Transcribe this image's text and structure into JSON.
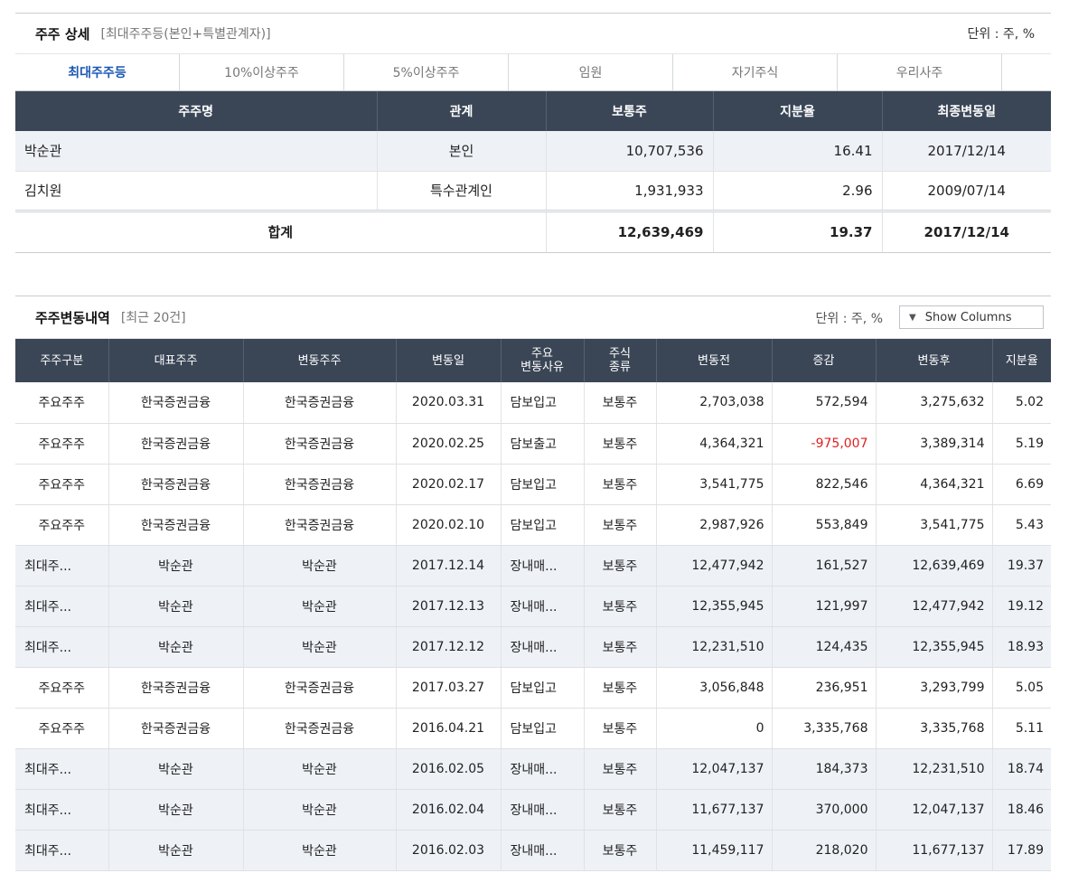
{
  "detail": {
    "title": "주주 상세",
    "subtitle": "[최대주주등(본인+특별관계자)]",
    "unit": "단위 : 주, %",
    "tabs": [
      "최대주주등",
      "10%이상주주",
      "5%이상주주",
      "임원",
      "자기주식",
      "우리사주",
      ""
    ],
    "active_tab": 0,
    "columns": [
      "주주명",
      "관계",
      "보통주",
      "지분율",
      "최종변동일"
    ],
    "rows": [
      {
        "name": "박순관",
        "relation": "본인",
        "common": "10,707,536",
        "ratio": "16.41",
        "date": "2017/12/14"
      },
      {
        "name": "김치원",
        "relation": "특수관계인",
        "common": "1,931,933",
        "ratio": "2.96",
        "date": "2009/07/14"
      }
    ],
    "total": {
      "label": "합계",
      "common": "12,639,469",
      "ratio": "19.37",
      "date": "2017/12/14"
    }
  },
  "changes": {
    "title": "주주변동내역",
    "subtitle": "[최근 20건]",
    "unit": "단위 : 주, %",
    "show_columns": "Show Columns",
    "columns": [
      "주주구분",
      "대표주주",
      "변동주주",
      "변동일",
      "주요\n변동사유",
      "주식\n종류",
      "변동전",
      "증감",
      "변동후",
      "지분율"
    ],
    "rows": [
      {
        "type": "주요주주",
        "rep": "한국증권금융",
        "holder": "한국증권금융",
        "date": "2020.03.31",
        "reason": "담보입고",
        "kind": "보통주",
        "before": "2,703,038",
        "delta": "572,594",
        "after": "3,275,632",
        "ratio": "5.02",
        "negative": false
      },
      {
        "type": "주요주주",
        "rep": "한국증권금융",
        "holder": "한국증권금융",
        "date": "2020.02.25",
        "reason": "담보출고",
        "kind": "보통주",
        "before": "4,364,321",
        "delta": "-975,007",
        "after": "3,389,314",
        "ratio": "5.19",
        "negative": true
      },
      {
        "type": "주요주주",
        "rep": "한국증권금융",
        "holder": "한국증권금융",
        "date": "2020.02.17",
        "reason": "담보입고",
        "kind": "보통주",
        "before": "3,541,775",
        "delta": "822,546",
        "after": "4,364,321",
        "ratio": "6.69",
        "negative": false
      },
      {
        "type": "주요주주",
        "rep": "한국증권금융",
        "holder": "한국증권금융",
        "date": "2020.02.10",
        "reason": "담보입고",
        "kind": "보통주",
        "before": "2,987,926",
        "delta": "553,849",
        "after": "3,541,775",
        "ratio": "5.43",
        "negative": false
      },
      {
        "type": "최대주...",
        "rep": "박순관",
        "holder": "박순관",
        "date": "2017.12.14",
        "reason": "장내매...",
        "kind": "보통주",
        "before": "12,477,942",
        "delta": "161,527",
        "after": "12,639,469",
        "ratio": "19.37",
        "negative": false
      },
      {
        "type": "최대주...",
        "rep": "박순관",
        "holder": "박순관",
        "date": "2017.12.13",
        "reason": "장내매...",
        "kind": "보통주",
        "before": "12,355,945",
        "delta": "121,997",
        "after": "12,477,942",
        "ratio": "19.12",
        "negative": false
      },
      {
        "type": "최대주...",
        "rep": "박순관",
        "holder": "박순관",
        "date": "2017.12.12",
        "reason": "장내매...",
        "kind": "보통주",
        "before": "12,231,510",
        "delta": "124,435",
        "after": "12,355,945",
        "ratio": "18.93",
        "negative": false
      },
      {
        "type": "주요주주",
        "rep": "한국증권금융",
        "holder": "한국증권금융",
        "date": "2017.03.27",
        "reason": "담보입고",
        "kind": "보통주",
        "before": "3,056,848",
        "delta": "236,951",
        "after": "3,293,799",
        "ratio": "5.05",
        "negative": false
      },
      {
        "type": "주요주주",
        "rep": "한국증권금융",
        "holder": "한국증권금융",
        "date": "2016.04.21",
        "reason": "담보입고",
        "kind": "보통주",
        "before": "0",
        "delta": "3,335,768",
        "after": "3,335,768",
        "ratio": "5.11",
        "negative": false
      },
      {
        "type": "최대주...",
        "rep": "박순관",
        "holder": "박순관",
        "date": "2016.02.05",
        "reason": "장내매...",
        "kind": "보통주",
        "before": "12,047,137",
        "delta": "184,373",
        "after": "12,231,510",
        "ratio": "18.74",
        "negative": false
      },
      {
        "type": "최대주...",
        "rep": "박순관",
        "holder": "박순관",
        "date": "2016.02.04",
        "reason": "장내매...",
        "kind": "보통주",
        "before": "11,677,137",
        "delta": "370,000",
        "after": "12,047,137",
        "ratio": "18.46",
        "negative": false
      },
      {
        "type": "최대주...",
        "rep": "박순관",
        "holder": "박순관",
        "date": "2016.02.03",
        "reason": "장내매...",
        "kind": "보통주",
        "before": "11,459,117",
        "delta": "218,020",
        "after": "11,677,137",
        "ratio": "17.89",
        "negative": false
      }
    ]
  }
}
